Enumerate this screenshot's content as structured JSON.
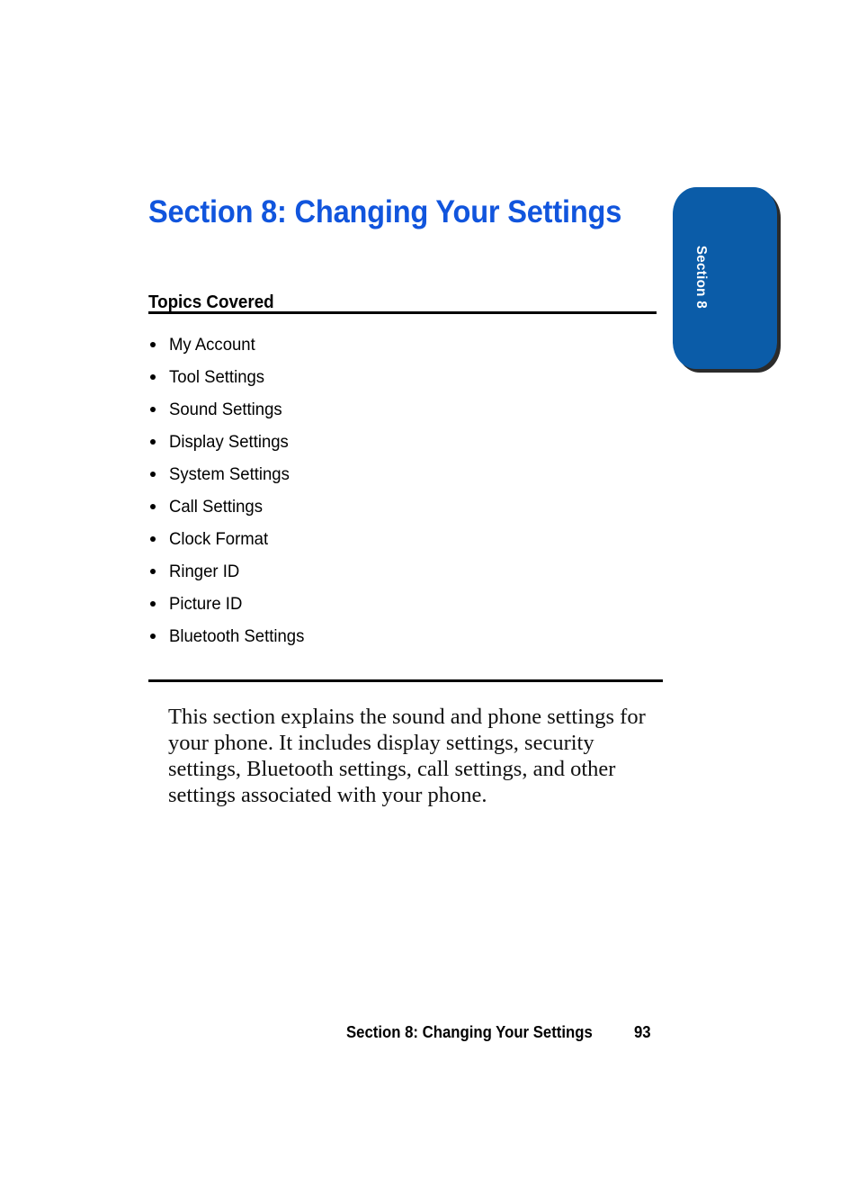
{
  "page": {
    "background_color": "#ffffff",
    "accent_blue": "#1155dd",
    "tab_blue": "#0b5ca8",
    "text_color": "#000000"
  },
  "section_title": "Section 8: Changing Your Settings",
  "side_tab": {
    "label": "Section 8"
  },
  "topics": {
    "heading": "Topics Covered",
    "items": [
      {
        "label": "My Account"
      },
      {
        "label": "Tool Settings"
      },
      {
        "label": "Sound Settings"
      },
      {
        "label": "Display Settings"
      },
      {
        "label": "System Settings"
      },
      {
        "label": "Call Settings"
      },
      {
        "label": "Clock Format"
      },
      {
        "label": "Ringer ID"
      },
      {
        "label": "Picture ID"
      },
      {
        "label": "Bluetooth Settings"
      }
    ]
  },
  "intro": {
    "paragraph": "This section explains the sound and phone settings for your phone. It includes display settings, security settings, Bluetooth settings, call settings, and other settings associated with your phone."
  },
  "footer": {
    "title": "Section 8: Changing Your Settings",
    "page_number": "93"
  }
}
